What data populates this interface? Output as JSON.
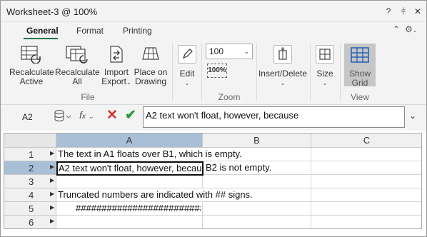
{
  "window": {
    "title": "Worksheet-3 @ 100%",
    "help": "?",
    "pin": "↕",
    "close": "✕"
  },
  "ribbon_tabs": [
    {
      "label": "General",
      "active": true
    },
    {
      "label": "Format",
      "active": false
    },
    {
      "label": "Printing",
      "active": false
    }
  ],
  "ribbon": {
    "file_group": {
      "label": "File",
      "recalc_active": [
        "Recalculate",
        "Active"
      ],
      "recalc_all": [
        "Recalculate",
        "All"
      ],
      "import_export": [
        "Import",
        "Export"
      ],
      "place_on_drawing": [
        "Place on",
        "Drawing"
      ]
    },
    "edit_label": "Edit",
    "zoom_group": {
      "label": "Zoom",
      "value": "100",
      "fit_text": "100%"
    },
    "insert_delete_label": "Insert/Delete",
    "size_label": "Size",
    "view_group": {
      "label": "View",
      "show_grid": [
        "Show",
        "Grid"
      ]
    }
  },
  "formula_bar": {
    "cell_ref": "A2",
    "value": "A2 text won't float, however, because"
  },
  "sheet": {
    "columns": [
      "A",
      "B",
      "C"
    ],
    "selected_column": "A",
    "rows": [
      "1",
      "2",
      "3",
      "4",
      "5",
      "6"
    ],
    "selected_row": "2",
    "cells": {
      "A1": "The text in A1 floats over B1, which is empty.",
      "A2": "A2 text won't float, however, because",
      "B2": "B2 is not empty.",
      "A4": "Truncated numbers are indicated with ## signs.",
      "A5": "##########################"
    }
  },
  "colors": {
    "accent": "#217346",
    "selection_header": "#a9bfd6",
    "cancel": "#d32f2f",
    "confirm": "#2e9a3f"
  }
}
